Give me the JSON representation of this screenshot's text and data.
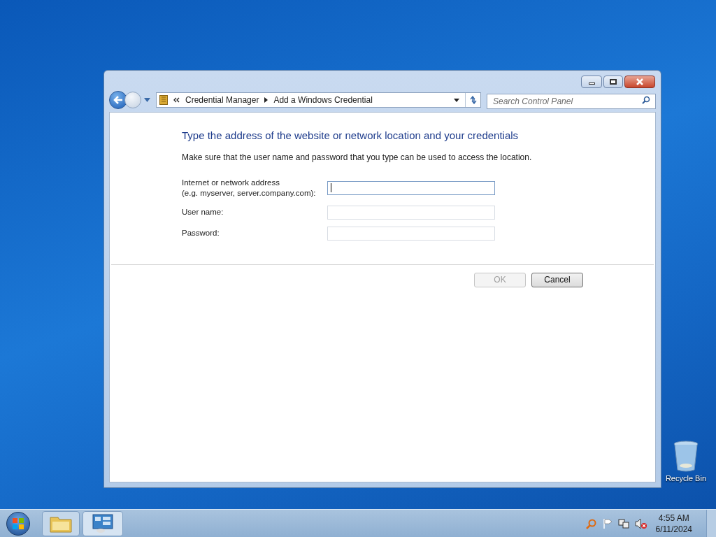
{
  "window": {
    "address_bar": {
      "breadcrumbs": [
        "Credential Manager",
        "Add a Windows Credential"
      ]
    },
    "search": {
      "placeholder": "Search Control Panel"
    },
    "heading": "Type the address of the website or network location and your credentials",
    "instructions": "Make sure that the user name and password that you type can be used to access the location.",
    "fields": [
      {
        "label_lines": [
          "Internet or network address",
          "(e.g. myserver, server.company.com):"
        ],
        "focused": true
      },
      {
        "label_lines": [
          "User name:"
        ],
        "focused": false
      },
      {
        "label_lines": [
          "Password:"
        ],
        "focused": false
      }
    ],
    "buttons": [
      {
        "label": "OK",
        "disabled": true
      },
      {
        "label": "Cancel",
        "disabled": false
      }
    ]
  },
  "desktop_icons": [
    {
      "label": "Recycle Bin"
    }
  ],
  "taskbar": {
    "clock": {
      "time": "4:55 AM",
      "date": "6/11/2024"
    }
  }
}
